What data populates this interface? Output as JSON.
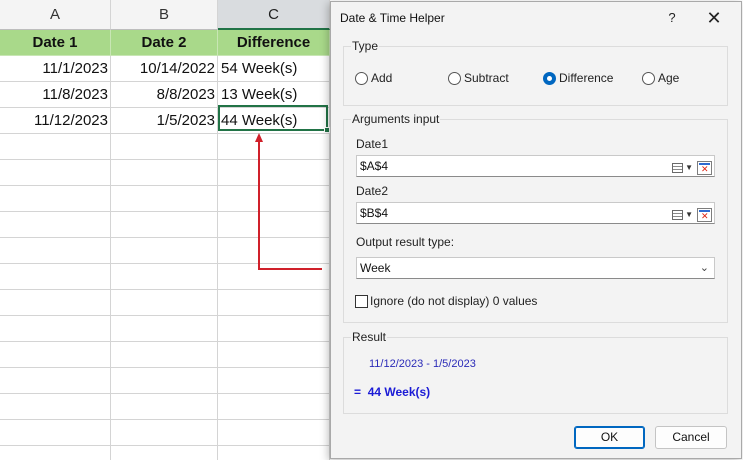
{
  "sheet": {
    "columns": [
      "A",
      "B",
      "C"
    ],
    "header_row": [
      "Date 1",
      "Date 2",
      "Difference"
    ],
    "rows": [
      [
        "11/1/2023",
        "10/14/2022",
        "54 Week(s)"
      ],
      [
        "11/8/2023",
        "8/8/2023",
        "13 Week(s)"
      ],
      [
        "11/12/2023",
        "1/5/2023",
        "44 Week(s)"
      ]
    ]
  },
  "dialog": {
    "title": "Date & Time Helper",
    "help": "?",
    "close": "✕",
    "type_group": {
      "label": "Type",
      "options": [
        "Add",
        "Subtract",
        "Difference",
        "Age"
      ],
      "selected": "Difference"
    },
    "arguments_group": {
      "label": "Arguments input",
      "date1_label": "Date1",
      "date1_value": "$A$4",
      "date2_label": "Date2",
      "date2_value": "$B$4",
      "output_label": "Output result type:",
      "output_value": "Week",
      "ignore_label": "Ignore (do not display) 0 values"
    },
    "result_group": {
      "label": "Result",
      "range_text": "11/12/2023 - 1/5/2023",
      "eq": "=",
      "value_text": "44 Week(s)"
    },
    "ok_label": "OK",
    "cancel_label": "Cancel"
  },
  "colors": {
    "header_fill": "#a9d98a",
    "active_border": "#217346",
    "arrow": "#d0202a",
    "radio_selected": "#0067c0",
    "result_text": "#1b1bd6"
  }
}
